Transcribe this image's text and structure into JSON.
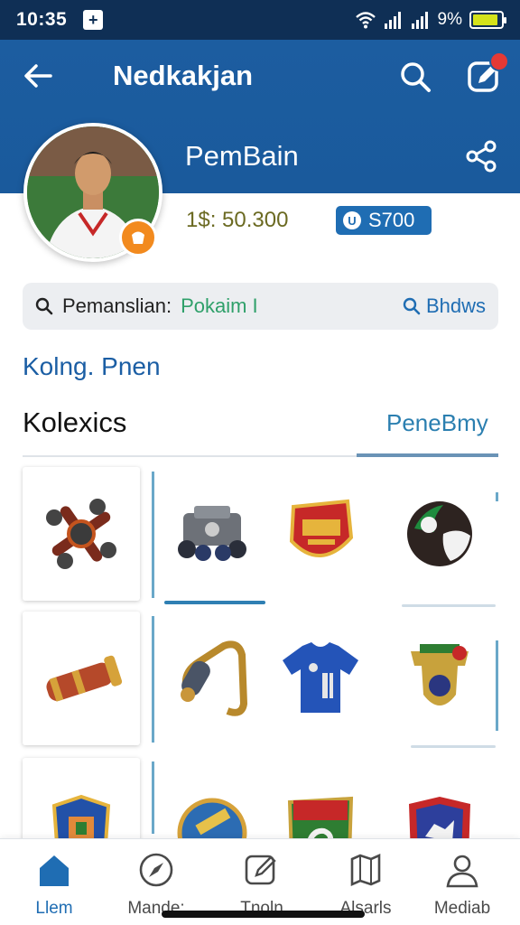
{
  "status_bar": {
    "time": "10:35",
    "notif_icon": "+",
    "battery_pct": "9%",
    "battery_level": 0.9
  },
  "app_bar": {
    "title": "Nedkakjan"
  },
  "profile": {
    "name": "PemBain",
    "balance": "1$: 50.300",
    "coin_badge": "S700",
    "coin_symbol": "U"
  },
  "search": {
    "label": "Pemanslian:",
    "value": "Pokaim I",
    "action": "Bhdws"
  },
  "section_link": "Kolng. Pnen",
  "tabs": {
    "left": "Kolexics",
    "right": "PeneBmy"
  },
  "items": [
    {
      "name": "fidget-spinner-item",
      "icon": "spinner"
    },
    {
      "name": "robot-tank-item",
      "icon": "tank"
    },
    {
      "name": "red-badge-item",
      "icon": "badge-red"
    },
    {
      "name": "soccer-ball-item",
      "icon": "ball"
    },
    {
      "name": "telescope-item",
      "icon": "telescope"
    },
    {
      "name": "horn-item",
      "icon": "horn"
    },
    {
      "name": "blue-jersey-item",
      "icon": "jersey"
    },
    {
      "name": "medal-item",
      "icon": "medal"
    },
    {
      "name": "crest-item",
      "icon": "crest"
    },
    {
      "name": "yellow-badge-item",
      "icon": "badge-yellow"
    },
    {
      "name": "shield-item",
      "icon": "shield"
    },
    {
      "name": "blue-crest-item",
      "icon": "crest-blue"
    }
  ],
  "bottom_nav": [
    {
      "label": "Llem",
      "icon": "home-icon",
      "active": true
    },
    {
      "label": "Mande:",
      "icon": "compass-icon",
      "active": false
    },
    {
      "label": "Tnoln",
      "icon": "edit-icon",
      "active": false
    },
    {
      "label": "Alsarls",
      "icon": "map-icon",
      "active": false
    },
    {
      "label": "Mediab",
      "icon": "profile-icon",
      "active": false
    }
  ],
  "colors": {
    "primary": "#1c5da0",
    "status_bar": "#0f2f55",
    "accent": "#f28a1e"
  }
}
